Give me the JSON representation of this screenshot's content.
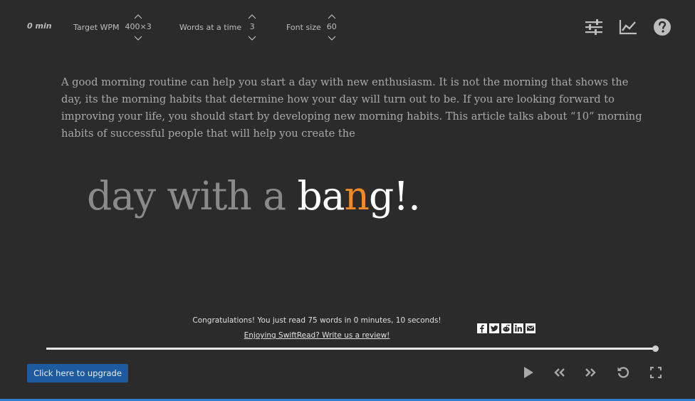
{
  "header": {
    "time_elapsed": "0 min",
    "wpm": {
      "label": "Target WPM",
      "value": "400×3"
    },
    "words_at_a_time": {
      "label": "Words at a time",
      "value": "3"
    },
    "font_size": {
      "label": "Font size",
      "value": "60"
    }
  },
  "tools": [
    "settings-sliders-icon",
    "stats-chart-icon",
    "help-icon"
  ],
  "reader": {
    "passage": "A good morning routine can help you start a day with new enthusiasm. It is not the morning that shows the day, its the morning habits that determine how your day will turn out to be. If you are looking forward to improving your life, you should start by developing new morning habits. This article talks about “10” morning habits of successful people that will help you create the",
    "focus_before": "day with a ",
    "focus_word_start": "ba",
    "focus_pivot": "n",
    "focus_word_end": "g!."
  },
  "footer": {
    "congrats": "Congratulations! You just read 75 words in 0 minutes, 10 seconds!",
    "review_link": "Enjoying SwiftRead? Write us a review!",
    "share": [
      "facebook-icon",
      "twitter-icon",
      "reddit-icon",
      "linkedin-icon",
      "email-icon"
    ],
    "progress_fraction": 1.0,
    "upgrade_label": "Click here to upgrade",
    "playback": [
      "play-icon",
      "rewind-icon",
      "fast-forward-icon",
      "restart-icon",
      "fullscreen-icon"
    ]
  },
  "colors": {
    "background": "#2b2b2b",
    "pivot": "#f08a24",
    "upgrade": "#1e5aa0"
  }
}
